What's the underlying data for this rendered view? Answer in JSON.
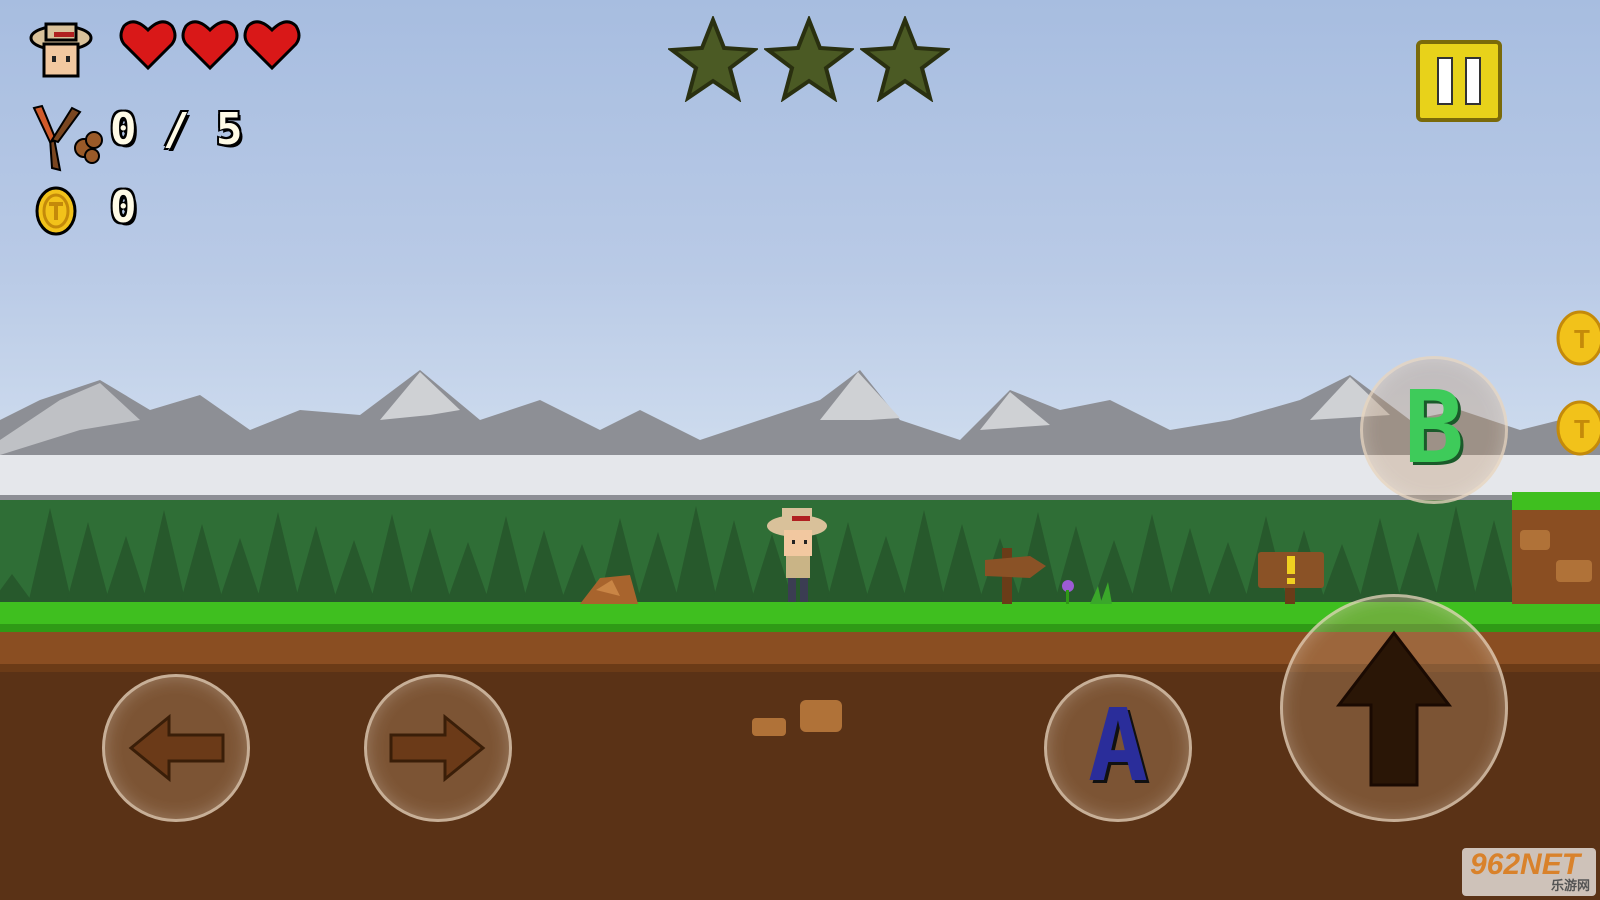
{
  "hud": {
    "lives": {
      "current": 3,
      "max": 3
    },
    "level_stars": {
      "earned": 0,
      "total": 3
    },
    "slingshot_ammo": {
      "current": "0",
      "separator": "/",
      "max": "5"
    },
    "coins": "0"
  },
  "controls": {
    "left_button": {
      "icon": "left-arrow-icon"
    },
    "right_button": {
      "icon": "right-arrow-icon"
    },
    "a_button": {
      "label": "A"
    },
    "b_button": {
      "label": "B"
    },
    "jump_button": {
      "icon": "up-arrow-icon"
    },
    "pause_button": {
      "icon": "pause-icon"
    }
  },
  "watermark": {
    "brand": "962NET",
    "sub": "乐游网"
  },
  "colors": {
    "sky_top": "#a7bde0",
    "grass": "#3fbf1f",
    "dirt": "#5a3216",
    "heart": "#d91818",
    "star_empty": "#4b5a24",
    "pause_yellow": "#e8d21a",
    "b_green": "#3ecb5a",
    "a_blue": "#2a2d9a"
  }
}
